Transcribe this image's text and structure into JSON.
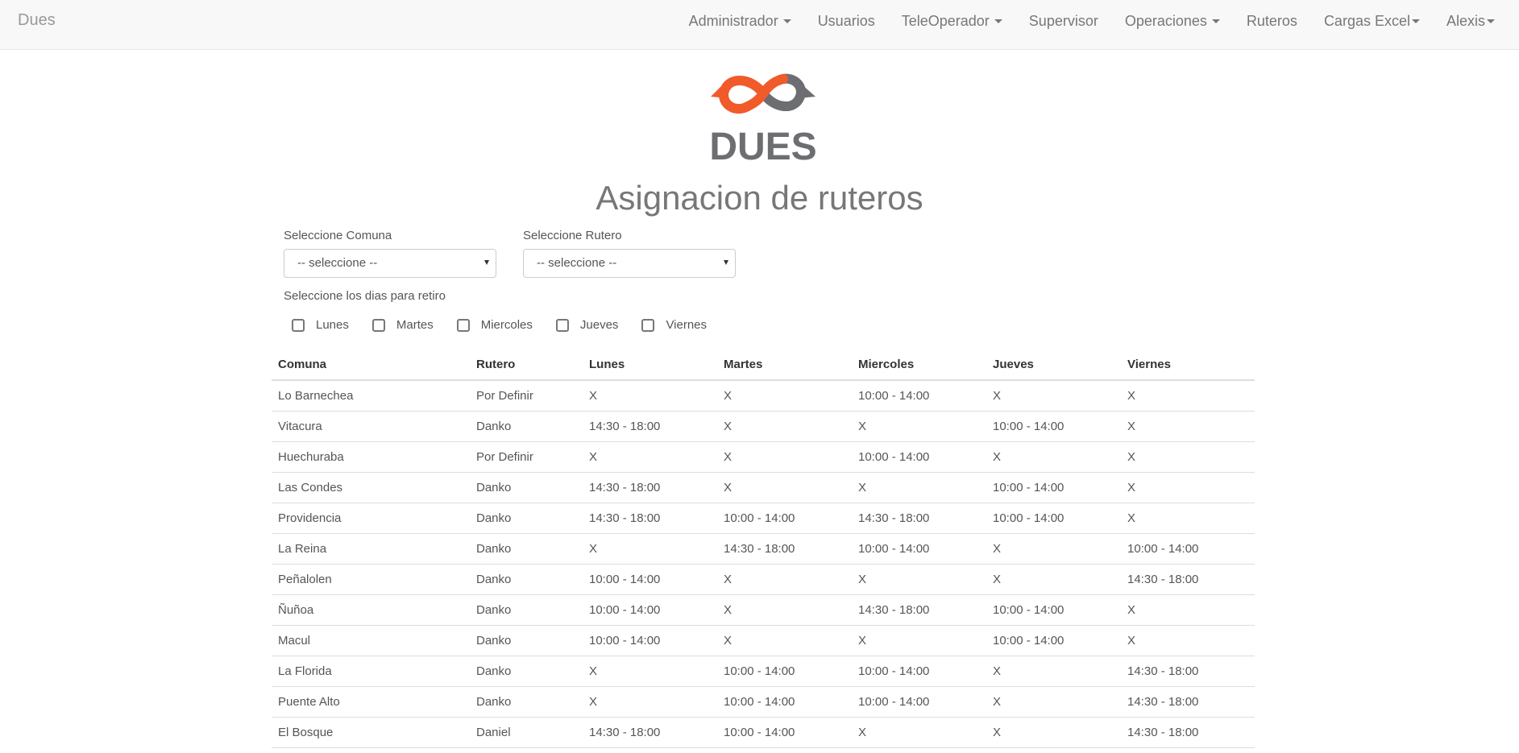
{
  "brand": "Dues",
  "nav": [
    {
      "label": "Administrador",
      "caret": true,
      "tight": false
    },
    {
      "label": "Usuarios",
      "caret": false,
      "tight": false
    },
    {
      "label": "TeleOperador",
      "caret": true,
      "tight": false
    },
    {
      "label": "Supervisor",
      "caret": false,
      "tight": false
    },
    {
      "label": "Operaciones",
      "caret": true,
      "tight": false
    },
    {
      "label": "Ruteros",
      "caret": false,
      "tight": false
    },
    {
      "label": "Cargas Excel",
      "caret": true,
      "tight": true
    },
    {
      "label": "Alexis",
      "caret": true,
      "tight": true
    }
  ],
  "logo": {
    "text": "DUES",
    "colors": {
      "orange": "#f15a29",
      "gray": "#6d6e71"
    }
  },
  "page_title": "Asignacion de ruteros",
  "form": {
    "comuna_label": "Seleccione Comuna",
    "comuna_value": "-- seleccione --",
    "rutero_label": "Seleccione Rutero",
    "rutero_value": "-- seleccione --",
    "dias_label": "Seleccione los dias para retiro",
    "dias": [
      "Lunes",
      "Martes",
      "Miercoles",
      "Jueves",
      "Viernes"
    ]
  },
  "table": {
    "headers": [
      "Comuna",
      "Rutero",
      "Lunes",
      "Martes",
      "Miercoles",
      "Jueves",
      "Viernes"
    ],
    "rows": [
      [
        "Lo Barnechea",
        "Por Definir",
        "X",
        "X",
        "10:00 - 14:00",
        "X",
        "X"
      ],
      [
        "Vitacura",
        "Danko",
        "14:30 - 18:00",
        "X",
        "X",
        "10:00 - 14:00",
        "X"
      ],
      [
        "Huechuraba",
        "Por Definir",
        "X",
        "X",
        "10:00 - 14:00",
        "X",
        "X"
      ],
      [
        "Las Condes",
        "Danko",
        "14:30 - 18:00",
        "X",
        "X",
        "10:00 - 14:00",
        "X"
      ],
      [
        "Providencia",
        "Danko",
        "14:30 - 18:00",
        "10:00 - 14:00",
        "14:30 - 18:00",
        "10:00 - 14:00",
        "X"
      ],
      [
        "La Reina",
        "Danko",
        "X",
        "14:30 - 18:00",
        "10:00 - 14:00",
        "X",
        "10:00 - 14:00"
      ],
      [
        "Peñalolen",
        "Danko",
        "10:00 - 14:00",
        "X",
        "X",
        "X",
        "14:30 - 18:00"
      ],
      [
        "Ñuñoa",
        "Danko",
        "10:00 - 14:00",
        "X",
        "14:30 - 18:00",
        "10:00 - 14:00",
        "X"
      ],
      [
        "Macul",
        "Danko",
        "10:00 - 14:00",
        "X",
        "X",
        "10:00 - 14:00",
        "X"
      ],
      [
        "La Florida",
        "Danko",
        "X",
        "10:00 - 14:00",
        "10:00 - 14:00",
        "X",
        "14:30 - 18:00"
      ],
      [
        "Puente Alto",
        "Danko",
        "X",
        "10:00 - 14:00",
        "10:00 - 14:00",
        "X",
        "14:30 - 18:00"
      ],
      [
        "El Bosque",
        "Daniel",
        "14:30 - 18:00",
        "10:00 - 14:00",
        "X",
        "X",
        "14:30 - 18:00"
      ]
    ]
  }
}
